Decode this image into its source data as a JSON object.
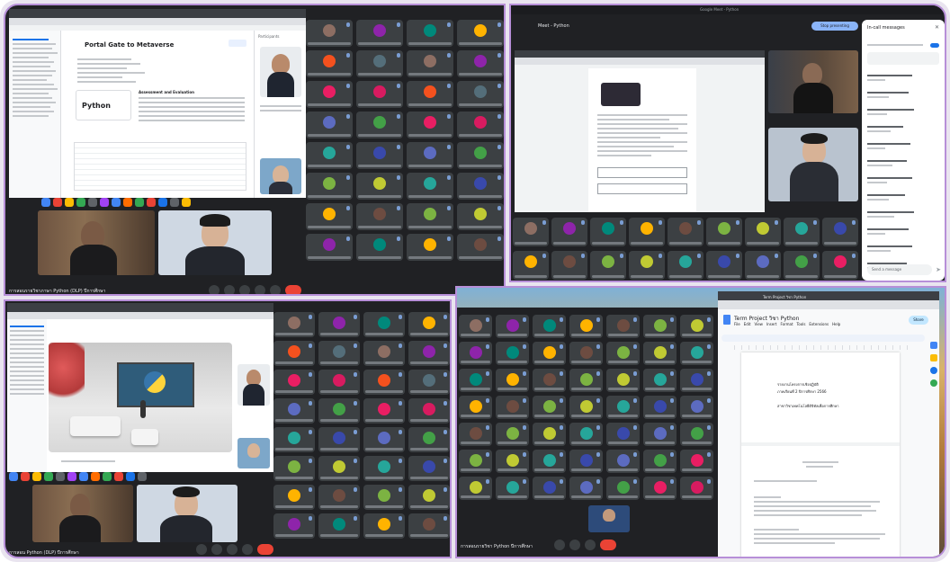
{
  "tl": {
    "slide_heading": "Portal Gate to Metaverse",
    "slide_course_label": "Python",
    "slide_card_title": "Assessment and Evaluation",
    "footer_text": "การสอนรายวิชาภาษา Python (DLP) ปีการศึกษา"
  },
  "tr": {
    "window_title": "Google Meet - Python",
    "banner": "Meet - Python",
    "present_button": "Stop presenting",
    "chat_header": "In-call messages",
    "chat_input": "Send a message"
  },
  "bl": {
    "footer_text": "การสอน Python (DLP) ปีการศึกษา"
  },
  "br": {
    "browser_tab": "Term Project วิชา Python",
    "doc_title": "Term Project วิชา Python",
    "menu": [
      "File",
      "Edit",
      "View",
      "Insert",
      "Format",
      "Tools",
      "Extensions",
      "Help"
    ],
    "share_button": "Share",
    "doc_text_line1": "รายงานโครงการเชิงปฏิบัติ",
    "doc_text_line2": "ภาคเรียนที่ 2 ปีการศึกษา 2566",
    "doc_text_line3": "สาขาวิชาเทคโนโลยีดิจิทัลเพื่อการศึกษา",
    "footer_text": "การสอนรายวิชา Python ปีการศึกษา"
  }
}
